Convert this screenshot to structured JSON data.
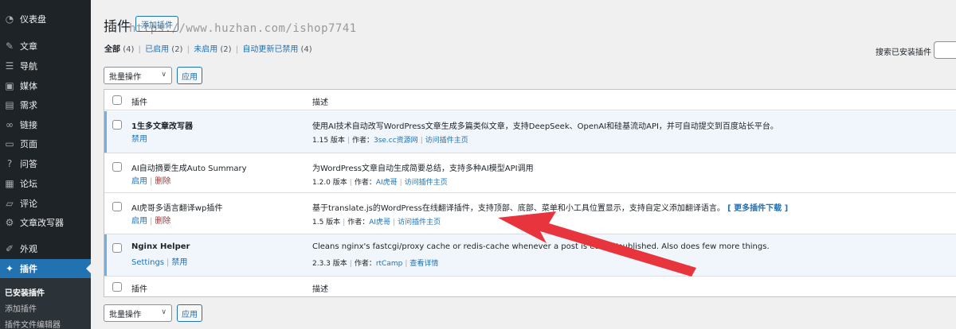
{
  "sidebar": {
    "items": [
      {
        "label": "仪表盘",
        "icon": "dashboard-icon"
      },
      {
        "label": "文章",
        "icon": "pushpin-icon"
      },
      {
        "label": "导航",
        "icon": "list-icon"
      },
      {
        "label": "媒体",
        "icon": "media-icon"
      },
      {
        "label": "需求",
        "icon": "edit-icon"
      },
      {
        "label": "链接",
        "icon": "link-icon"
      },
      {
        "label": "页面",
        "icon": "page-icon"
      },
      {
        "label": "问答",
        "icon": "question-icon"
      },
      {
        "label": "论坛",
        "icon": "forum-icon"
      },
      {
        "label": "评论",
        "icon": "comment-icon"
      },
      {
        "label": "文章改写器",
        "icon": "rewrite-icon"
      },
      {
        "label": "外观",
        "icon": "brush-icon"
      },
      {
        "label": "插件",
        "icon": "plugin-icon"
      }
    ],
    "submenu": [
      "已安装插件",
      "添加插件",
      "插件文件编辑器"
    ]
  },
  "header": {
    "title": "插件",
    "add_new": "添加插件",
    "watermark": "https://www.huzhan.com/ishop7741"
  },
  "filters": [
    {
      "label": "全部",
      "count": "(4)"
    },
    {
      "label": "已启用",
      "count": "(2)"
    },
    {
      "label": "未启用",
      "count": "(2)"
    },
    {
      "label": "自动更新已禁用",
      "count": "(4)"
    }
  ],
  "search": {
    "label": "搜索已安装插件"
  },
  "bulk": {
    "label": "批量操作",
    "apply": "应用"
  },
  "table": {
    "col_plugin": "插件",
    "col_desc": "描述",
    "rows": [
      {
        "name": "1生多文章改写器",
        "actions": [
          "禁用"
        ],
        "desc": "使用AI技术自动改写WordPress文章生成多篇类似文章，支持DeepSeek、OpenAI和硅基流动API，并可自动提交到百度站长平台。",
        "version": "1.15 版本",
        "author_prefix": "作者：",
        "author": "3se.cc资源网",
        "link": "访问插件主页"
      },
      {
        "name": "AI自动摘要生成Auto Summary",
        "actions": [
          "启用",
          "删除"
        ],
        "desc": "为WordPress文章自动生成简要总结，支持多种AI模型API调用",
        "version": "1.2.0 版本",
        "author_prefix": "作者：",
        "author": "AI虎哥",
        "link": "访问插件主页"
      },
      {
        "name": "AI虎哥多语言翻译wp插件",
        "actions": [
          "启用",
          "删除"
        ],
        "desc": "基于translate.js的WordPress在线翻译插件，支持顶部、底部、菜单和小工具位置显示，支持自定义添加翻译语言。",
        "more": "[ 更多插件下载 ]",
        "version": "1.5 版本",
        "author_prefix": "作者：",
        "author": "AI虎哥",
        "link": "访问插件主页"
      },
      {
        "name": "Nginx Helper",
        "actions": [
          "Settings",
          "禁用"
        ],
        "desc": "Cleans nginx's fastcgi/proxy cache or redis-cache whenever a post is edited/published. Also does few more things.",
        "version": "2.3.3 版本",
        "author_prefix": "作者：",
        "author": "rtCamp",
        "link": "查看详情"
      }
    ]
  },
  "colors": {
    "accent": "#2271b1",
    "sidebar": "#1d2327",
    "arrow": "#e8343c",
    "delete": "#b32d2e"
  }
}
